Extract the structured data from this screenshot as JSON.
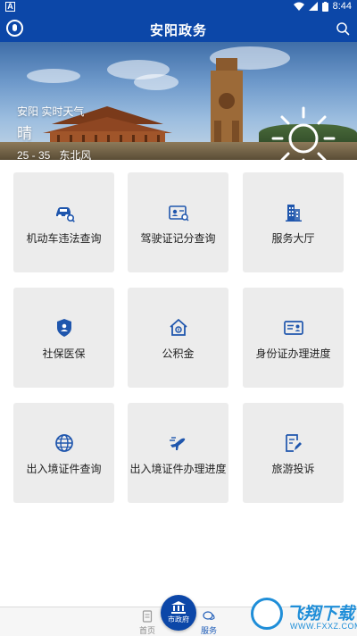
{
  "status_bar": {
    "left_icon_letter": "A",
    "time": "8:44"
  },
  "app_bar": {
    "title": "安阳政务",
    "left_icon": "user-icon",
    "right_icon": "search-icon"
  },
  "banner": {
    "city_label": "安阳 实时天气",
    "condition": "晴",
    "temperature": "25 - 35",
    "wind": "东北风",
    "weather_icon": "sun-icon"
  },
  "services": [
    {
      "label": "机动车违法查询",
      "icon": "car-search-icon"
    },
    {
      "label": "驾驶证记分查询",
      "icon": "license-card-icon"
    },
    {
      "label": "服务大厅",
      "icon": "building-icon"
    },
    {
      "label": "社保医保",
      "icon": "shield-medical-icon"
    },
    {
      "label": "公积金",
      "icon": "house-fund-icon"
    },
    {
      "label": "身份证办理进度",
      "icon": "id-card-icon"
    },
    {
      "label": "出入境证件查询",
      "icon": "globe-icon"
    },
    {
      "label": "出入境证件办理进度",
      "icon": "airplane-icon"
    },
    {
      "label": "旅游投诉",
      "icon": "edit-form-icon"
    }
  ],
  "bottom_nav": {
    "home_label": "首页",
    "center_label": "市政府",
    "service_label": "服务"
  },
  "colors": {
    "primary": "#0c47a8",
    "tile_bg": "#ececec",
    "icon": "#1f56ad",
    "active_nav": "#1f5db8"
  },
  "watermark": {
    "text": "飞翔下载",
    "url": "WWW.FXXZ.COM"
  }
}
